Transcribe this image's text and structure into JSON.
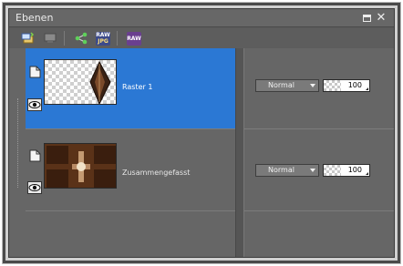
{
  "panel": {
    "title": "Ebenen"
  },
  "window_controls": {
    "maximize_icon": "maximize-icon",
    "close_icon": "close-icon",
    "close_glyph": "✕"
  },
  "toolbar": {
    "icons": [
      "new-layer-icon",
      "properties-icon",
      "link-share-icon",
      "raw-jpg-icon",
      "raw-icon"
    ],
    "raw_jpg_top": "RAW",
    "raw_jpg_bottom": "JPG",
    "raw_label": "RAW"
  },
  "layers": [
    {
      "name": "Raster 1",
      "blend_mode": "Normal",
      "opacity": "100",
      "selected": true
    },
    {
      "name": "Zusammengefasst",
      "blend_mode": "Normal",
      "opacity": "100",
      "selected": false
    }
  ],
  "colors": {
    "selection": "#2b78d4",
    "panel_bg": "#666666"
  }
}
